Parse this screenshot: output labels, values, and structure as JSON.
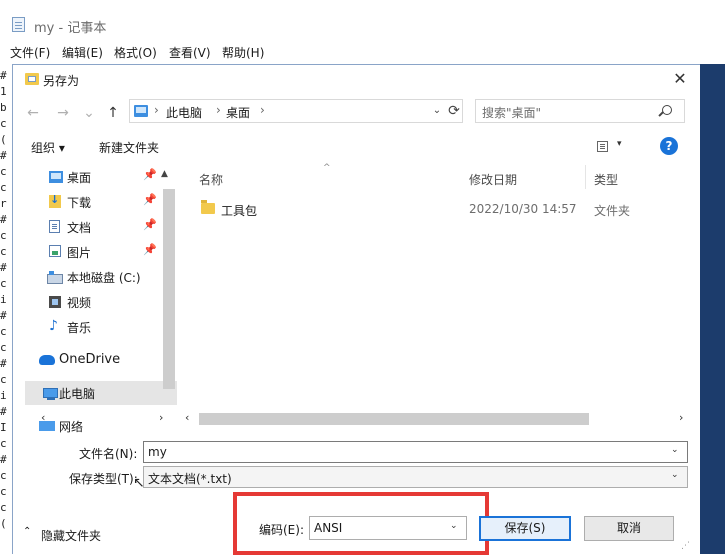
{
  "notepad": {
    "title": "my - 记事本",
    "menu": [
      "文件(F)",
      "编辑(E)",
      "格式(O)",
      "查看(V)",
      "帮助(H)"
    ],
    "text_lines": [
      "#",
      "1",
      "b",
      "c",
      "(",
      "#",
      "c",
      "c",
      "r",
      "#",
      "c",
      "c",
      "#",
      "c",
      "i",
      "#",
      "c",
      "c",
      "#",
      "c",
      "i",
      "#",
      "I",
      "c",
      "#",
      "c",
      "c",
      "c",
      "("
    ]
  },
  "dialog": {
    "title": "另存为",
    "close_glyph": "✕",
    "nav": {
      "back": "←",
      "forward": "→",
      "recent": "⌄",
      "up": "↑"
    },
    "address": {
      "path": [
        "此电脑",
        "桌面"
      ],
      "sep": "›",
      "dropdown": "⌄",
      "refresh": "⟳"
    },
    "search": {
      "placeholder": "搜索\"桌面\""
    },
    "toolbar": {
      "organize": "组织 ▾",
      "new_folder": "新建文件夹",
      "view_caret": "▾",
      "help": "?"
    },
    "nav_pane": {
      "items": [
        {
          "label": "桌面",
          "icon": "desktop-icon",
          "pinned": true
        },
        {
          "label": "下载",
          "icon": "download-icon",
          "pinned": true
        },
        {
          "label": "文档",
          "icon": "document-icon",
          "pinned": true
        },
        {
          "label": "图片",
          "icon": "picture-icon",
          "pinned": true
        },
        {
          "label": "本地磁盘 (C:)",
          "icon": "disk-icon",
          "pinned": false
        },
        {
          "label": "视频",
          "icon": "video-icon",
          "pinned": false
        },
        {
          "label": "音乐",
          "icon": "music-icon",
          "pinned": false
        },
        {
          "label": "OneDrive",
          "icon": "cloud-icon",
          "pinned": false
        },
        {
          "label": "此电脑",
          "icon": "computer-icon",
          "pinned": false,
          "selected": true
        }
      ],
      "network": "网络",
      "pin_glyph": "📌"
    },
    "file_list": {
      "columns": [
        "名称",
        "修改日期",
        "类型"
      ],
      "rows": [
        {
          "name": "工具包",
          "modified": "2022/10/30 14:57",
          "type": "文件夹"
        }
      ]
    },
    "form": {
      "filename_label": "文件名(N):",
      "filename_value": "my",
      "filetype_label": "保存类型(T):",
      "filetype_value": "文本文档(*.txt)"
    },
    "footer": {
      "hide_folders": "隐藏文件夹",
      "encoding_label": "编码(E):",
      "encoding_value": "ANSI",
      "save": "保存(S)",
      "cancel": "取消"
    }
  },
  "colors": {
    "accent": "#1a73d8",
    "highlight": "#e53935",
    "folder": "#f2c94c",
    "selected_bg": "#e5e5e5"
  }
}
